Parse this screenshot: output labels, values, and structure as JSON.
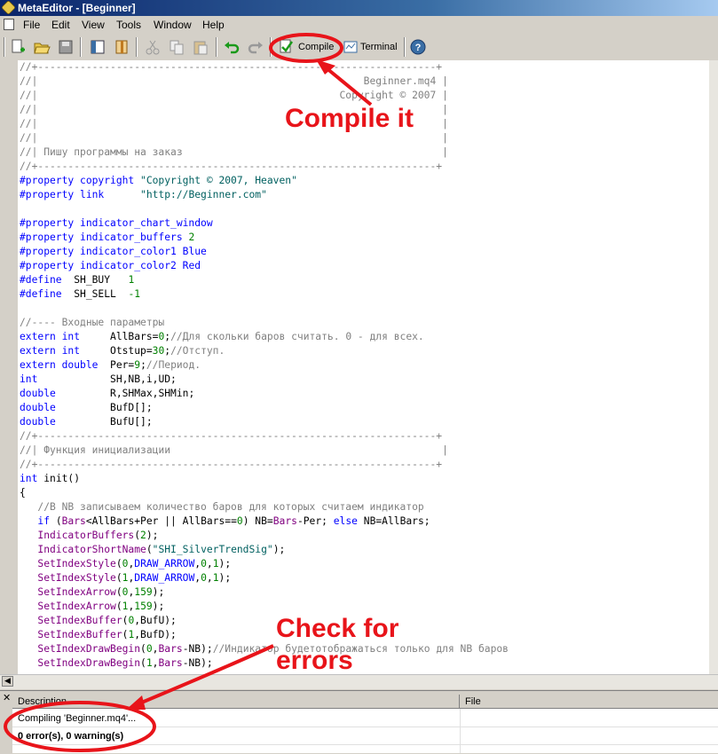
{
  "window": {
    "title": "MetaEditor - [Beginner]"
  },
  "menu": [
    "File",
    "Edit",
    "View",
    "Tools",
    "Window",
    "Help"
  ],
  "toolbar": {
    "compile_label": "Compile",
    "terminal_label": "Terminal"
  },
  "code": {
    "lines": [
      [
        [
          "cm",
          "//+------------------------------------------------------------------+"
        ]
      ],
      [
        [
          "cm",
          "//|                                                      Beginner.mq4 |"
        ]
      ],
      [
        [
          "cm",
          "//|                                                  Copyright © 2007 |"
        ]
      ],
      [
        [
          "cm",
          "//|                                                                   |"
        ]
      ],
      [
        [
          "cm",
          "//|                                                                   |"
        ]
      ],
      [
        [
          "cm",
          "//|                                                                   |"
        ]
      ],
      [
        [
          "cm",
          "//| Пишу программы на заказ                                           |"
        ]
      ],
      [
        [
          "cm",
          "//+------------------------------------------------------------------+"
        ]
      ],
      [
        [
          "kw",
          "#property copyright "
        ],
        [
          "str",
          "\"Copyright © 2007, Heaven\""
        ]
      ],
      [
        [
          "kw",
          "#property link      "
        ],
        [
          "str",
          "\"http://Beginner.com\""
        ]
      ],
      [],
      [
        [
          "kw",
          "#property indicator_chart_window"
        ]
      ],
      [
        [
          "kw",
          "#property indicator_buffers "
        ],
        [
          "num",
          "2"
        ]
      ],
      [
        [
          "kw",
          "#property indicator_color1 "
        ],
        [
          "kw",
          "Blue"
        ]
      ],
      [
        [
          "kw",
          "#property indicator_color2 "
        ],
        [
          "kw",
          "Red"
        ]
      ],
      [
        [
          "kw",
          "#define  "
        ],
        [
          "",
          "SH_BUY   "
        ],
        [
          "num",
          "1"
        ]
      ],
      [
        [
          "kw",
          "#define  "
        ],
        [
          "",
          "SH_SELL  "
        ],
        [
          "num",
          "-1"
        ]
      ],
      [],
      [
        [
          "cm",
          "//---- Входные параметры"
        ]
      ],
      [
        [
          "kw",
          "extern int     "
        ],
        [
          "",
          "AllBars="
        ],
        [
          "num",
          "0"
        ],
        [
          "",
          ";"
        ],
        [
          "cm",
          "//Для скольки баров считать. 0 - для всех."
        ]
      ],
      [
        [
          "kw",
          "extern int     "
        ],
        [
          "",
          "Otstup="
        ],
        [
          "num",
          "30"
        ],
        [
          "",
          ";"
        ],
        [
          "cm",
          "//Отступ."
        ]
      ],
      [
        [
          "kw",
          "extern double  "
        ],
        [
          "",
          "Per="
        ],
        [
          "num",
          "9"
        ],
        [
          "",
          ";"
        ],
        [
          "cm",
          "//Период."
        ]
      ],
      [
        [
          "kw",
          "int            "
        ],
        [
          "",
          "SH,NB,i,UD;"
        ]
      ],
      [
        [
          "kw",
          "double         "
        ],
        [
          "",
          "R,SHMax,SHMin;"
        ]
      ],
      [
        [
          "kw",
          "double         "
        ],
        [
          "",
          "BufD[];"
        ]
      ],
      [
        [
          "kw",
          "double         "
        ],
        [
          "",
          "BufU[];"
        ]
      ],
      [
        [
          "cm",
          "//+------------------------------------------------------------------+"
        ]
      ],
      [
        [
          "cm",
          "//| Функция инициализации                                             |"
        ]
      ],
      [
        [
          "cm",
          "//+------------------------------------------------------------------+"
        ]
      ],
      [
        [
          "kw",
          "int "
        ],
        [
          "",
          "init()"
        ]
      ],
      [
        [
          "",
          "{"
        ]
      ],
      [
        [
          "cm",
          "   //В NB записываем количество баров для которых считаем индикатор"
        ]
      ],
      [
        [
          "",
          "   "
        ],
        [
          "kw",
          "if"
        ],
        [
          "",
          " ("
        ],
        [
          "fn",
          "Bars"
        ],
        [
          "",
          "<AllBars+Per || AllBars=="
        ],
        [
          "num",
          "0"
        ],
        [
          "",
          ") NB="
        ],
        [
          "fn",
          "Bars"
        ],
        [
          "",
          "-Per; "
        ],
        [
          "kw",
          "else"
        ],
        [
          "",
          " NB=AllBars;"
        ]
      ],
      [
        [
          "",
          "   "
        ],
        [
          "fn",
          "IndicatorBuffers"
        ],
        [
          "",
          "("
        ],
        [
          "num",
          "2"
        ],
        [
          "",
          ");"
        ]
      ],
      [
        [
          "",
          "   "
        ],
        [
          "fn",
          "IndicatorShortName"
        ],
        [
          "",
          "("
        ],
        [
          "str",
          "\"SHI_SilverTrendSig\""
        ],
        [
          "",
          ");"
        ]
      ],
      [
        [
          "",
          "   "
        ],
        [
          "fn",
          "SetIndexStyle"
        ],
        [
          "",
          "("
        ],
        [
          "num",
          "0"
        ],
        [
          "",
          ","
        ],
        [
          "kw",
          "DRAW_ARROW"
        ],
        [
          "",
          ","
        ],
        [
          "num",
          "0"
        ],
        [
          "",
          ","
        ],
        [
          "num",
          "1"
        ],
        [
          "",
          ");"
        ]
      ],
      [
        [
          "",
          "   "
        ],
        [
          "fn",
          "SetIndexStyle"
        ],
        [
          "",
          "("
        ],
        [
          "num",
          "1"
        ],
        [
          "",
          ","
        ],
        [
          "kw",
          "DRAW_ARROW"
        ],
        [
          "",
          ","
        ],
        [
          "num",
          "0"
        ],
        [
          "",
          ","
        ],
        [
          "num",
          "1"
        ],
        [
          "",
          ");"
        ]
      ],
      [
        [
          "",
          "   "
        ],
        [
          "fn",
          "SetIndexArrow"
        ],
        [
          "",
          "("
        ],
        [
          "num",
          "0"
        ],
        [
          "",
          ","
        ],
        [
          "num",
          "159"
        ],
        [
          "",
          ");"
        ]
      ],
      [
        [
          "",
          "   "
        ],
        [
          "fn",
          "SetIndexArrow"
        ],
        [
          "",
          "("
        ],
        [
          "num",
          "1"
        ],
        [
          "",
          ","
        ],
        [
          "num",
          "159"
        ],
        [
          "",
          ");"
        ]
      ],
      [
        [
          "",
          "   "
        ],
        [
          "fn",
          "SetIndexBuffer"
        ],
        [
          "",
          "("
        ],
        [
          "num",
          "0"
        ],
        [
          "",
          ",BufU);"
        ]
      ],
      [
        [
          "",
          "   "
        ],
        [
          "fn",
          "SetIndexBuffer"
        ],
        [
          "",
          "("
        ],
        [
          "num",
          "1"
        ],
        [
          "",
          ",BufD);"
        ]
      ],
      [
        [
          "",
          "   "
        ],
        [
          "fn",
          "SetIndexDrawBegin"
        ],
        [
          "",
          "("
        ],
        [
          "num",
          "0"
        ],
        [
          "",
          ","
        ],
        [
          "fn",
          "Bars"
        ],
        [
          "",
          "-NB);"
        ],
        [
          "cm",
          "//Индикатор будетотображаться только для NB баров"
        ]
      ],
      [
        [
          "",
          "   "
        ],
        [
          "fn",
          "SetIndexDrawBegin"
        ],
        [
          "",
          "("
        ],
        [
          "num",
          "1"
        ],
        [
          "",
          ","
        ],
        [
          "fn",
          "Bars"
        ],
        [
          "",
          "-NB);"
        ]
      ]
    ]
  },
  "output": {
    "columns": [
      "Description",
      "File"
    ],
    "rows": [
      {
        "description": "Compiling 'Beginner.mq4'...",
        "file": ""
      },
      {
        "description": "0 error(s), 0 warning(s)",
        "file": ""
      }
    ]
  },
  "annotations": {
    "compile": "Compile it",
    "check_line1": "Check for",
    "check_line2": "errors",
    "color": "#e8141a"
  },
  "colors": {
    "comment": "#808080",
    "keyword": "#0000ff",
    "number": "#008000",
    "string": "#006060",
    "function": "#800080"
  }
}
